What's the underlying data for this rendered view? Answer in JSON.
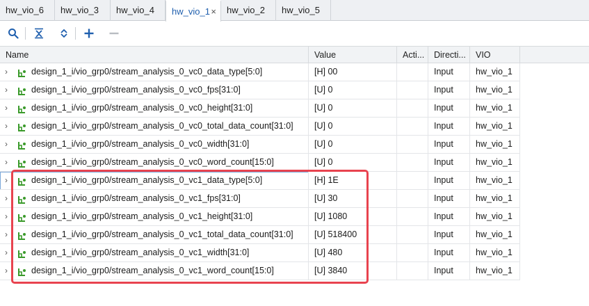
{
  "tabs": [
    {
      "label": "hw_vio_6"
    },
    {
      "label": "hw_vio_3"
    },
    {
      "label": "hw_vio_4"
    },
    {
      "label": "hw_vio_1",
      "close": "×"
    },
    {
      "label": "hw_vio_2"
    },
    {
      "label": "hw_vio_5"
    }
  ],
  "toolbar": {
    "icons": [
      "search-icon",
      "collapse-all-icon",
      "expand-all-icon",
      "add-icon",
      "remove-icon"
    ]
  },
  "columns": {
    "name": "Name",
    "value": "Value",
    "activity": "Acti...",
    "direction": "Directi...",
    "vio": "VIO"
  },
  "rows": [
    {
      "name": "design_1_i/vio_grp0/stream_analysis_0_vc0_data_type[5:0]",
      "value": "[H] 00",
      "activity": "",
      "direction": "Input",
      "vio": "hw_vio_1"
    },
    {
      "name": "design_1_i/vio_grp0/stream_analysis_0_vc0_fps[31:0]",
      "value": "[U] 0",
      "activity": "",
      "direction": "Input",
      "vio": "hw_vio_1"
    },
    {
      "name": "design_1_i/vio_grp0/stream_analysis_0_vc0_height[31:0]",
      "value": "[U] 0",
      "activity": "",
      "direction": "Input",
      "vio": "hw_vio_1"
    },
    {
      "name": "design_1_i/vio_grp0/stream_analysis_0_vc0_total_data_count[31:0]",
      "value": "[U] 0",
      "activity": "",
      "direction": "Input",
      "vio": "hw_vio_1"
    },
    {
      "name": "design_1_i/vio_grp0/stream_analysis_0_vc0_width[31:0]",
      "value": "[U] 0",
      "activity": "",
      "direction": "Input",
      "vio": "hw_vio_1"
    },
    {
      "name": "design_1_i/vio_grp0/stream_analysis_0_vc0_word_count[15:0]",
      "value": "[U] 0",
      "activity": "",
      "direction": "Input",
      "vio": "hw_vio_1"
    },
    {
      "name": "design_1_i/vio_grp0/stream_analysis_0_vc1_data_type[5:0]",
      "value": "[H] 1E",
      "activity": "",
      "direction": "Input",
      "vio": "hw_vio_1"
    },
    {
      "name": "design_1_i/vio_grp0/stream_analysis_0_vc1_fps[31:0]",
      "value": "[U] 30",
      "activity": "",
      "direction": "Input",
      "vio": "hw_vio_1"
    },
    {
      "name": "design_1_i/vio_grp0/stream_analysis_0_vc1_height[31:0]",
      "value": "[U] 1080",
      "activity": "",
      "direction": "Input",
      "vio": "hw_vio_1"
    },
    {
      "name": "design_1_i/vio_grp0/stream_analysis_0_vc1_total_data_count[31:0]",
      "value": "[U] 518400",
      "activity": "",
      "direction": "Input",
      "vio": "hw_vio_1"
    },
    {
      "name": "design_1_i/vio_grp0/stream_analysis_0_vc1_width[31:0]",
      "value": "[U] 480",
      "activity": "",
      "direction": "Input",
      "vio": "hw_vio_1"
    },
    {
      "name": "design_1_i/vio_grp0/stream_analysis_0_vc1_word_count[15:0]",
      "value": "[U] 3840",
      "activity": "",
      "direction": "Input",
      "vio": "hw_vio_1"
    }
  ],
  "colors": {
    "accent": "#1f5fae",
    "highlight": "#e8434f",
    "probe_icon": "#3a9a2a"
  }
}
